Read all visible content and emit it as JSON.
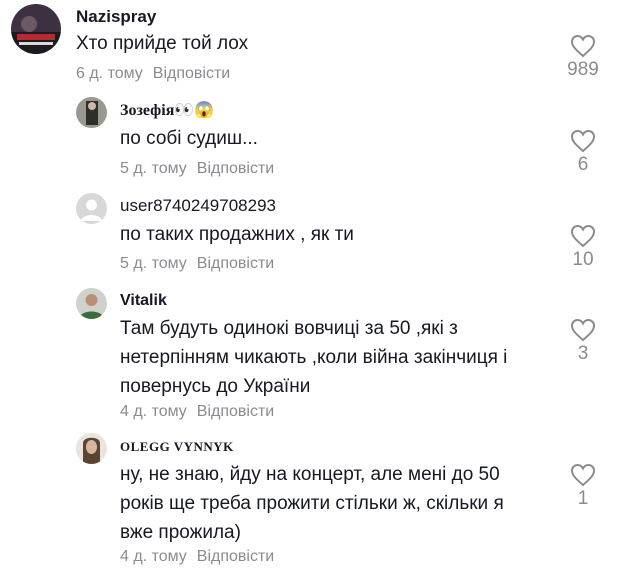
{
  "comments": [
    {
      "username": "Nazispray",
      "text": "Хто прийде той лох",
      "time": "6 д. тому",
      "reply_label": "Відповісти",
      "likes": "989"
    },
    {
      "username": "Зозефія👀😱",
      "text": "по собі судиш...",
      "time": "5 д. тому",
      "reply_label": "Відповісти",
      "likes": "6"
    },
    {
      "username": "user8740249708293",
      "text": "по таких продажних , як ти",
      "time": "5 д. тому",
      "reply_label": "Відповісти",
      "likes": "10"
    },
    {
      "username": "Vitalik",
      "text_lines": [
        "Там будуть одинокі вовчиці за 50 ,які з",
        "нетерпінням чикають ,коли війна закінчиця і",
        "повернусь до України"
      ],
      "time": "4 д. тому",
      "reply_label": "Відповісти",
      "likes": "3"
    },
    {
      "username": "OLEGG VYNNYK",
      "text_lines": [
        "ну, не знаю, йду на концерт, але мені до 50",
        "років ще треба прожити стільки ж, скільки я",
        "вже прожила)"
      ],
      "time": "4 д. тому",
      "reply_label": "Відповісти",
      "likes": "1"
    }
  ]
}
